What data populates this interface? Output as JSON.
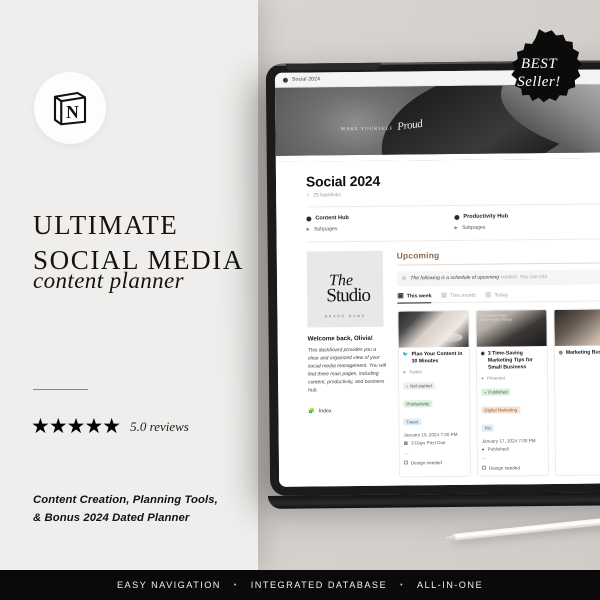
{
  "brand": {
    "logo_icon": "notion-logo-icon",
    "logo_alt": "Notion"
  },
  "hero": {
    "title_line1": "ULTIMATE",
    "title_line2": "SOCIAL MEDIA",
    "subtitle": "content planner",
    "rating_stars": "★★★★★",
    "rating_text": "5.0 reviews",
    "features_line1": "Content Creation, Planning Tools,",
    "features_line2": "& Bonus 2024 Dated Planner"
  },
  "badge": {
    "line1": "BEST",
    "line2": "Seller!"
  },
  "footer": {
    "items": [
      "EASY NAVIGATION",
      "INTEGRATED DATABASE",
      "ALL-IN-ONE"
    ],
    "separator": "•"
  },
  "tablet": {
    "browser_tab": {
      "favicon": "page-dot-icon",
      "title": "Social 2024"
    },
    "cover": {
      "text_small": "MAKE YOURSELF",
      "text_script": "Proud"
    },
    "page": {
      "title": "Social 2024",
      "backlinks": "25 backlinks",
      "backlinks_icon": "checkmark-icon",
      "hubs": [
        {
          "label": "Content Hub",
          "sub_label": "Subpages"
        },
        {
          "label": "Productivity Hub",
          "sub_label": "Subpages"
        }
      ],
      "left_column": {
        "image_line1": "The",
        "image_line2": "Studio",
        "image_caption": "BRAND NAME",
        "welcome_title": "Welcome back, Olivia!",
        "welcome_body": "This dashboard provides you a clear and organized view of your social media management. You will find three main pages, including content, productivity, and business hub.",
        "index_label": "Index",
        "index_icon": "puzzle-piece-icon"
      },
      "upcoming": {
        "heading": "Upcoming",
        "callout_icon": "info-circle-icon",
        "callout_text": "The following is a schedule of upcoming ",
        "callout_text_muted": "content. You can cha",
        "view_tabs": [
          {
            "label": "This week",
            "icon": "calendar-icon",
            "active": true
          },
          {
            "label": "This month",
            "icon": "calendar-icon",
            "active": false
          },
          {
            "label": "Today",
            "icon": "calendar-icon",
            "active": false
          }
        ],
        "cards": [
          {
            "icon": "twitter-bird-icon",
            "title": "Plan Your Content in 30 Minutes",
            "platform": "Twitter",
            "status_pill": "Not started",
            "category_pill": "Productivity",
            "type_pill": "Tweet",
            "date": "January 15, 2024 7:00 PM",
            "status_note": "3 Days Past Due",
            "status_note_icon": "clock-icon",
            "divider": "—",
            "checklist_item": "Design needed"
          },
          {
            "icon": "pinterest-icon",
            "title": "3 Time-Saving Marketing Tips for Small Business",
            "platform": "Pinterest",
            "status_pill": "Published",
            "category_pill": "Digital Marketing",
            "type_pill": "Pin",
            "date": "January 17, 2024 7:00 PM",
            "status_note": "Published!",
            "status_note_icon": "dot-icon",
            "divider": "—",
            "checklist_item": "Design needed"
          },
          {
            "icon": "instagram-icon",
            "title": "Marketing Business",
            "platform": "",
            "status_pill": "",
            "category_pill": "",
            "type_pill": "",
            "date": "",
            "status_note": "",
            "divider": "",
            "checklist_item": ""
          }
        ]
      }
    }
  },
  "colors": {
    "panel_bg": "#efeeec",
    "scene_bg": "#d7d3cf",
    "ink": "#101010",
    "accent_brown": "#8c6a4e",
    "bar_bg": "#0a0a0a"
  }
}
